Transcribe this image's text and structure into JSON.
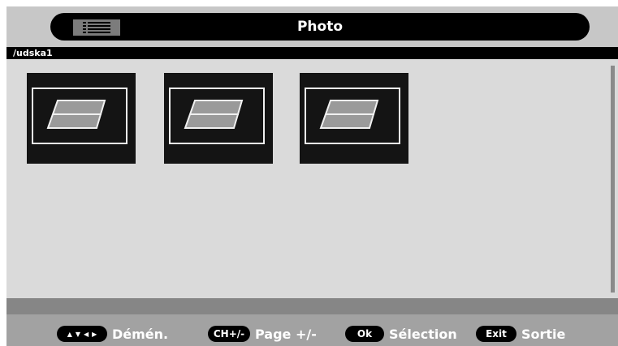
{
  "header": {
    "title": "Photo",
    "menu_icon": "list-icon"
  },
  "path": "/udska1",
  "thumbnails": [
    {
      "icon": "photo-placeholder-icon"
    },
    {
      "icon": "photo-placeholder-icon"
    },
    {
      "icon": "photo-placeholder-icon"
    }
  ],
  "footer": {
    "navigate": {
      "keys": [
        "▲",
        "▼",
        "◀",
        "▶"
      ],
      "label": "Démén."
    },
    "page": {
      "key": "CH+/-",
      "label": "Page +/-"
    },
    "select": {
      "key": "Ok",
      "label": "Sélection"
    },
    "exit": {
      "key": "Exit",
      "label": "Sortie"
    }
  },
  "colors": {
    "frame_bg": "#dadada",
    "bar_bg": "#000000",
    "footer_bg": "#a2a2a2"
  }
}
